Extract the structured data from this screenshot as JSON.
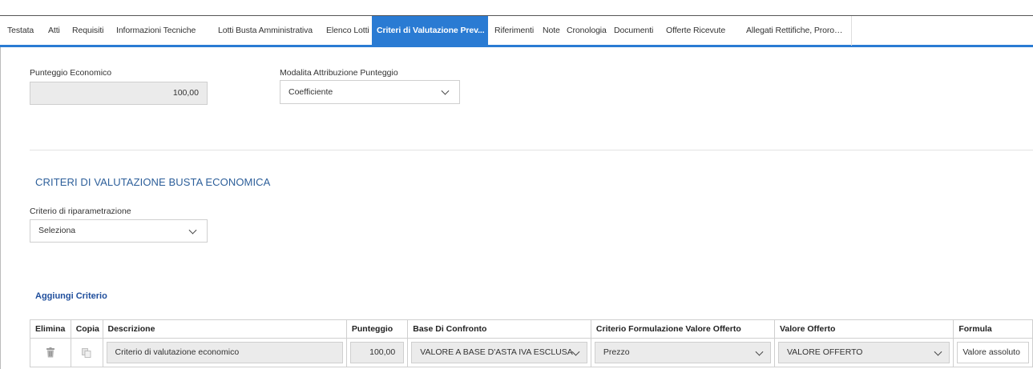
{
  "tabs": [
    {
      "label": "Testata"
    },
    {
      "label": "Atti"
    },
    {
      "label": "Requisiti"
    },
    {
      "label": "Informazioni Tecniche"
    },
    {
      "label": "Lotti"
    },
    {
      "label": "Busta Amministrativa"
    },
    {
      "label": "Elenco Lotti"
    },
    {
      "label": "Criteri di Valutazione Prev..."
    },
    {
      "label": "Riferimenti"
    },
    {
      "label": "Note"
    },
    {
      "label": "Cronologia"
    },
    {
      "label": "Documenti"
    },
    {
      "label": "Offerte Ricevute"
    },
    {
      "label": "Allegati Rettifiche, Proroghe..."
    }
  ],
  "tabs_active_index": 7,
  "punteggio": {
    "label": "Punteggio Economico",
    "value": "100,00"
  },
  "modalita": {
    "label": "Modalita Attribuzione Punteggio",
    "value": "Coefficiente"
  },
  "section": {
    "title": "CRITERI DI VALUTAZIONE BUSTA ECONOMICA"
  },
  "riparametrazione": {
    "label": "Criterio di riparametrazione",
    "value": "Seleziona"
  },
  "add_criterion": "Aggiungi Criterio",
  "table": {
    "headers": [
      "Elimina",
      "Copia",
      "Descrizione",
      "Punteggio",
      "Base Di Confronto",
      "Criterio Formulazione Valore Offerto",
      "Valore Offerto",
      "Formula"
    ],
    "rows": [
      {
        "descrizione": "Criterio di valutazione economico",
        "punteggio": "100,00",
        "base": "VALORE A BASE D'ASTA IVA ESCLUSA",
        "criterio_formulazione": "Prezzo",
        "valore_offerto": "VALORE OFFERTO",
        "formula": "Valore assoluto"
      }
    ]
  },
  "colors": {
    "accent": "#2a7bd3",
    "section_title": "#2d5f9a",
    "link": "#1f4e9c",
    "readonly_bg": "#ebebeb"
  }
}
